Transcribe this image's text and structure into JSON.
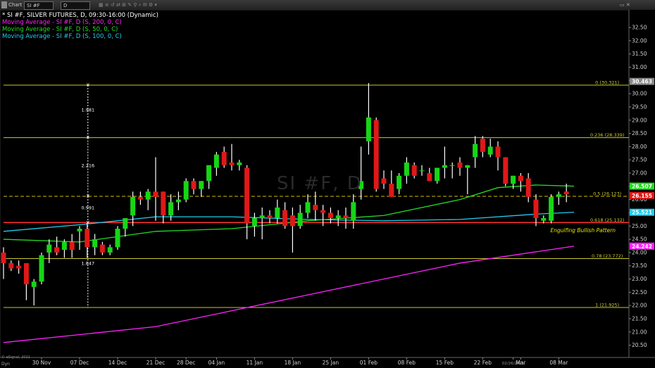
{
  "toolbar": {
    "chart_label": "Chart",
    "symbol": "SI #F",
    "interval": "D"
  },
  "legend": {
    "title": "* SI #F, SILVER FUTURES, D, 09:30-16:00 (Dynamic)",
    "ma200": "Moving Average - SI #F, D (S, 200, 0, C)",
    "ma50": "Moving Average - SI #F, D (S, 50, 0, C)",
    "ma100": "Moving Average - SI #F, D (S, 100, 0, C)"
  },
  "watermark": "SI #F, D",
  "corner_label": "© eSignal, 2021",
  "dyn_label": "Dyn",
  "colors": {
    "up": "#16d616",
    "down": "#e01818",
    "wick": "#ffffff",
    "ma200": "#ff22ff",
    "ma50": "#22dd22",
    "ma100": "#22ccee",
    "fib": "#c9c930",
    "red_level": "#ff3030",
    "dashed": "#d4c000",
    "axis_text": "#d0d0d0",
    "annotation": "#e6e600"
  },
  "chart_data": {
    "type": "candlestick",
    "title": "SI #F, SILVER FUTURES, D, 09:30-16:00 (Dynamic)",
    "ylim": [
      20.25,
      32.9
    ],
    "y_ticks": [
      "20.50",
      "21.00",
      "21.50",
      "22.00",
      "22.50",
      "23.00",
      "23.50",
      "24.00",
      "24.50",
      "25.00",
      "25.50",
      "26.00",
      "26.50",
      "27.00",
      "27.50",
      "28.00",
      "28.50",
      "29.00",
      "29.50",
      "30.00",
      "30.50",
      "31.00",
      "31.50",
      "32.00",
      "32.50"
    ],
    "x_ticks": [
      {
        "label": "30 Nov",
        "i": 5
      },
      {
        "label": "07 Dec",
        "i": 10
      },
      {
        "label": "14 Dec",
        "i": 15
      },
      {
        "label": "21 Dec",
        "i": 20
      },
      {
        "label": "28 Dec",
        "i": 24
      },
      {
        "label": "04 Jan",
        "i": 28
      },
      {
        "label": "11 Jan",
        "i": 33
      },
      {
        "label": "18 Jan",
        "i": 38
      },
      {
        "label": "25 Jan",
        "i": 43
      },
      {
        "label": "01 Feb",
        "i": 48
      },
      {
        "label": "08 Feb",
        "i": 53
      },
      {
        "label": "15 Feb",
        "i": 58
      },
      {
        "label": "22 Feb",
        "i": 63
      },
      {
        "label": "02/26/2021",
        "i": 67
      },
      {
        "label": "Mar",
        "i": 68
      },
      {
        "label": "08 Mar",
        "i": 73
      }
    ],
    "candles": [
      [
        24.0,
        24.2,
        23.0,
        23.6
      ],
      [
        23.6,
        23.7,
        23.3,
        23.4
      ],
      [
        23.5,
        23.7,
        23.2,
        23.4
      ],
      [
        23.6,
        23.6,
        22.2,
        22.8
      ],
      [
        22.7,
        23.0,
        22.0,
        22.9
      ],
      [
        22.9,
        24.0,
        22.8,
        23.9
      ],
      [
        24.0,
        24.5,
        23.6,
        24.3
      ],
      [
        24.2,
        24.6,
        23.9,
        24.0
      ],
      [
        24.1,
        24.5,
        23.8,
        24.4
      ],
      [
        24.4,
        24.7,
        23.8,
        24.1
      ],
      [
        24.8,
        25.0,
        24.1,
        24.9
      ],
      [
        24.9,
        25.1,
        23.8,
        24.2
      ],
      [
        24.2,
        24.7,
        23.9,
        24.5
      ],
      [
        24.3,
        24.4,
        23.9,
        24.0
      ],
      [
        24.0,
        24.3,
        23.9,
        24.2
      ],
      [
        24.2,
        25.0,
        24.1,
        24.9
      ],
      [
        24.9,
        25.3,
        24.6,
        25.3
      ],
      [
        25.4,
        26.3,
        25.0,
        26.1
      ],
      [
        26.1,
        26.3,
        25.8,
        26.0
      ],
      [
        26.0,
        26.4,
        25.6,
        26.3
      ],
      [
        26.3,
        27.6,
        25.2,
        26.1
      ],
      [
        26.3,
        26.3,
        25.1,
        25.4
      ],
      [
        25.4,
        26.2,
        25.2,
        25.9
      ],
      [
        25.9,
        26.3,
        25.6,
        26.0
      ],
      [
        26.0,
        26.8,
        25.9,
        26.7
      ],
      [
        26.7,
        26.8,
        26.2,
        26.4
      ],
      [
        26.4,
        26.7,
        26.1,
        26.7
      ],
      [
        26.7,
        27.2,
        26.4,
        27.3
      ],
      [
        27.2,
        27.8,
        26.9,
        27.7
      ],
      [
        27.8,
        28.0,
        27.2,
        27.3
      ],
      [
        27.4,
        28.1,
        27.1,
        27.3
      ],
      [
        27.3,
        27.5,
        27.1,
        27.4
      ],
      [
        27.2,
        27.3,
        24.5,
        25.1
      ],
      [
        25.0,
        25.5,
        24.6,
        25.3
      ],
      [
        25.3,
        25.7,
        24.5,
        25.4
      ],
      [
        25.4,
        25.6,
        25.1,
        25.3
      ],
      [
        25.3,
        26.0,
        25.1,
        25.7
      ],
      [
        25.6,
        25.9,
        24.9,
        25.0
      ],
      [
        25.4,
        25.7,
        24.0,
        25.0
      ],
      [
        25.0,
        25.8,
        24.9,
        25.5
      ],
      [
        25.5,
        26.2,
        25.3,
        25.9
      ],
      [
        25.8,
        26.3,
        25.2,
        25.6
      ],
      [
        25.6,
        25.8,
        25.0,
        25.5
      ],
      [
        25.5,
        25.7,
        25.1,
        25.3
      ],
      [
        25.3,
        25.6,
        25.0,
        25.4
      ],
      [
        25.4,
        25.7,
        24.9,
        25.3
      ],
      [
        25.2,
        26.2,
        24.9,
        25.9
      ],
      [
        26.4,
        28.0,
        26.0,
        26.7
      ],
      [
        28.2,
        30.4,
        27.7,
        29.1
      ],
      [
        29.0,
        29.1,
        26.3,
        26.4
      ],
      [
        26.8,
        27.1,
        26.4,
        26.6
      ],
      [
        26.6,
        27.1,
        26.1,
        26.1
      ],
      [
        26.4,
        27.0,
        26.2,
        26.9
      ],
      [
        26.9,
        27.6,
        26.6,
        27.4
      ],
      [
        27.3,
        27.4,
        26.8,
        26.9
      ],
      [
        27.1,
        27.3,
        26.9,
        27.1
      ],
      [
        27.0,
        27.2,
        26.7,
        26.7
      ],
      [
        26.7,
        27.2,
        26.6,
        27.2
      ],
      [
        27.2,
        28.0,
        26.8,
        27.3
      ],
      [
        27.3,
        27.4,
        26.8,
        27.3
      ],
      [
        27.4,
        27.6,
        26.9,
        27.2
      ],
      [
        27.2,
        27.3,
        26.2,
        27.3
      ],
      [
        27.6,
        28.4,
        27.2,
        28.1
      ],
      [
        28.3,
        28.4,
        27.6,
        27.8
      ],
      [
        27.7,
        28.3,
        27.6,
        28.0
      ],
      [
        28.0,
        28.2,
        27.1,
        27.6
      ],
      [
        27.6,
        27.6,
        26.5,
        26.6
      ],
      [
        26.6,
        26.9,
        26.4,
        26.9
      ],
      [
        26.9,
        27.0,
        26.3,
        26.7
      ],
      [
        26.8,
        27.0,
        25.9,
        26.1
      ],
      [
        26.0,
        26.2,
        25.0,
        25.3
      ],
      [
        25.2,
        25.4,
        25.1,
        25.3
      ],
      [
        25.2,
        26.2,
        25.1,
        26.1
      ],
      [
        26.1,
        26.3,
        25.8,
        26.2
      ],
      [
        26.3,
        26.6,
        25.9,
        26.2
      ]
    ],
    "ma200": {
      "name": "Moving Average (S, 200, 0, C)",
      "values": [
        [
          0,
          20.6
        ],
        [
          20,
          21.2
        ],
        [
          40,
          22.4
        ],
        [
          60,
          23.6
        ],
        [
          75,
          24.24
        ]
      ]
    },
    "ma50": {
      "name": "Moving Average (S, 50, 0, C)",
      "values": [
        [
          0,
          24.5
        ],
        [
          10,
          24.4
        ],
        [
          20,
          24.8
        ],
        [
          30,
          24.9
        ],
        [
          40,
          25.2
        ],
        [
          50,
          25.4
        ],
        [
          60,
          26.0
        ],
        [
          65,
          26.45
        ],
        [
          70,
          26.55
        ],
        [
          75,
          26.507
        ]
      ]
    },
    "ma100": {
      "name": "Moving Average (S, 100, 0, C)",
      "values": [
        [
          0,
          24.8
        ],
        [
          10,
          25.05
        ],
        [
          20,
          25.35
        ],
        [
          30,
          25.35
        ],
        [
          40,
          25.25
        ],
        [
          50,
          25.2
        ],
        [
          60,
          25.25
        ],
        [
          70,
          25.45
        ],
        [
          75,
          25.521
        ]
      ]
    },
    "fib_levels": [
      {
        "label": "0 (30.321)",
        "value": 30.321
      },
      {
        "label": "0.236 (28.339)",
        "value": 28.339
      },
      {
        "label": "0.5 (26.123)",
        "value": 26.123,
        "dashed": true
      },
      {
        "label": "0.618 (25.132)",
        "value": 25.132
      },
      {
        "label": "0.78 (23.772)",
        "value": 23.772
      },
      {
        "label": "1 (21.925)",
        "value": 21.925
      }
    ],
    "measure_lines": [
      {
        "from": 30.321,
        "to": 28.339,
        "label": "1.981"
      },
      {
        "from": 28.339,
        "to": 26.123,
        "label": "2.216"
      },
      {
        "from": 26.123,
        "to": 25.132,
        "label": "0.991"
      },
      {
        "from": 25.132,
        "to": 21.925,
        "label": "1.847"
      }
    ],
    "price_labels": [
      {
        "label": "30.463",
        "value": 30.463,
        "color": "#888888"
      },
      {
        "label": "26.507",
        "value": 26.507,
        "color": "#22dd22"
      },
      {
        "label": "26.155",
        "value": 26.155,
        "color": "#e01818"
      },
      {
        "label": "25.521",
        "value": 25.521,
        "color": "#22ccee"
      },
      {
        "label": "24.242",
        "value": 24.242,
        "color": "#ff22ff"
      }
    ],
    "annotation": "Engulfing Bullish Pattern"
  }
}
